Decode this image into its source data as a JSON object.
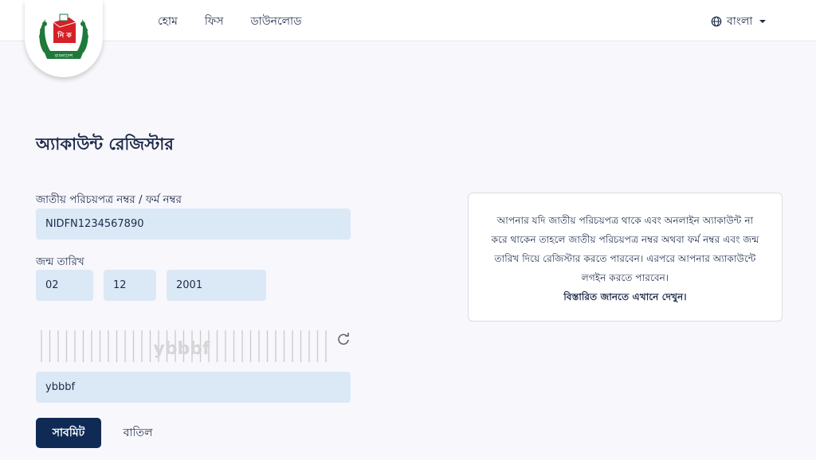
{
  "header": {
    "logo_text": "নি ক",
    "logo_ribbon": "বাংলাদেশ",
    "nav": [
      "হোম",
      "ফিস",
      "ডাউনলোড"
    ],
    "language": "বাংলা"
  },
  "form": {
    "title": "অ্যাকাউন্ট রেজিস্টার",
    "nid_label": "জাতীয় পরিচয়পত্র নম্বর / ফর্ম নম্বর",
    "nid_value": "NIDFN1234567890",
    "dob_label": "জন্ম তারিখ",
    "dob_day": "02",
    "dob_month": "12",
    "dob_year": "2001",
    "captcha_text": "ybbbf",
    "captcha_value": "ybbbf",
    "submit_label": "সাবমিট",
    "cancel_label": "বাতিল"
  },
  "info": {
    "text": "আপনার যদি জাতীয় পরিচয়পত্র থাকে এবং অনলাইন অ্যাকাউন্ট না করে থাকেন তাহলে জাতীয় পরিচয়পত্র নম্বর অথবা ফর্ম নম্বর এবং জন্ম তারিখ দিয়ে রেজিস্টার করতে পারবেন। এরপরে আপনার অ্যাকাউন্টে লগইন করতে পারবেন।",
    "link": "বিস্তারিত জানতে এখানে দেখুন।"
  },
  "colors": {
    "primary": "#0f2a55",
    "field_bg": "#dbe9f6",
    "logo_red": "#d61f26",
    "logo_green": "#1f7a3a"
  }
}
